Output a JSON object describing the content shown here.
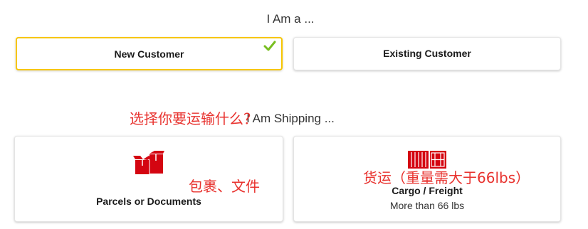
{
  "section_customer": {
    "heading": "I Am a ...",
    "options": [
      {
        "label": "New Customer",
        "selected": true
      },
      {
        "label": "Existing Customer",
        "selected": false
      }
    ]
  },
  "section_shipping": {
    "heading": "I Am Shipping ...",
    "options": [
      {
        "label": "Parcels or Documents",
        "icon": "parcels-icon"
      },
      {
        "label": "Cargo / Freight",
        "sublabel": "More than 66 lbs",
        "icon": "shipping-container-icon"
      }
    ]
  },
  "annotations": {
    "shipping_question": "选择你要运输什么？",
    "parcels_note": "包裹、文件",
    "cargo_note": "货运（重量需大于66lbs）"
  },
  "icons": {
    "selected_check": "checkmark-icon"
  },
  "colors": {
    "selected_border": "#f7c600",
    "check": "#78be20",
    "icon": "#d40511",
    "annotation": "#e8322e"
  }
}
